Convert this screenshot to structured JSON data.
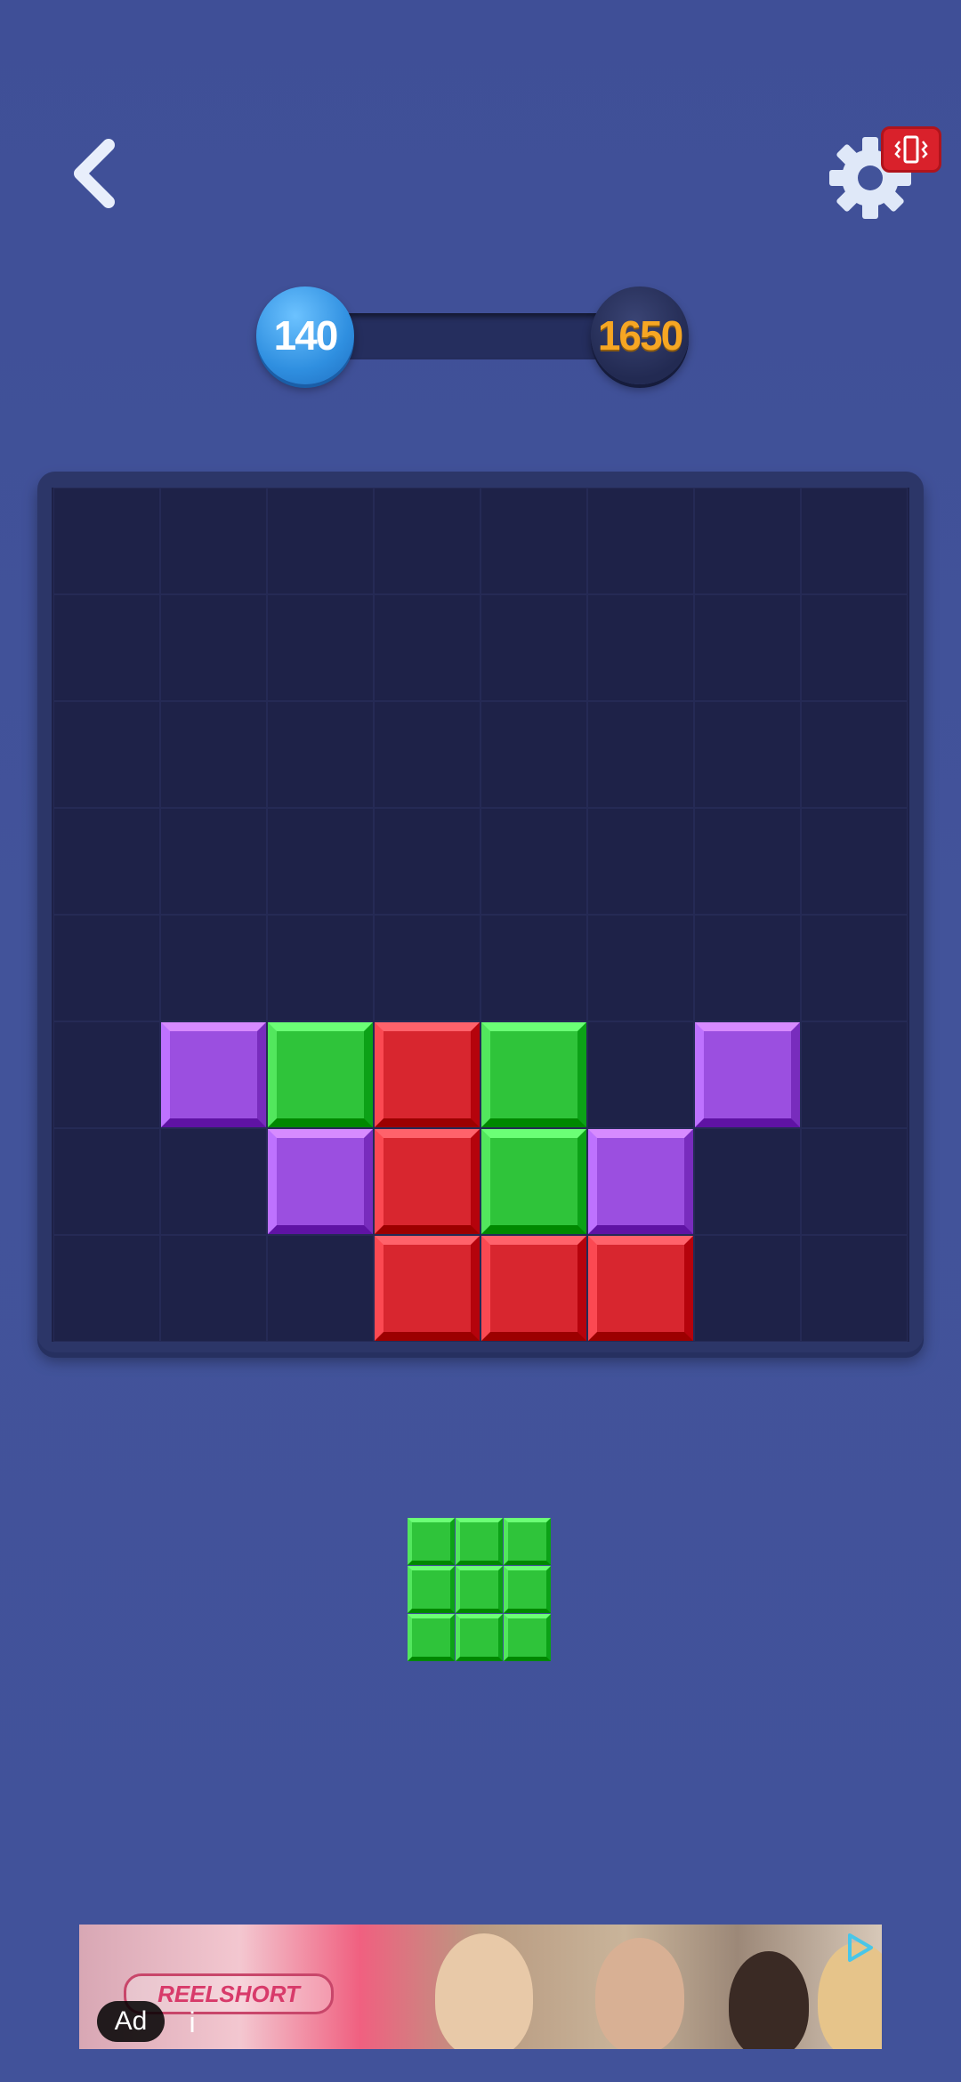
{
  "header": {
    "back_icon": "chevron-left-icon",
    "settings_icon": "gear-icon",
    "vibration_icon": "vibration-icon",
    "vibration_badge_color": "#d9212b"
  },
  "progress": {
    "current_score": "140",
    "target_score": "1650",
    "fraction": 0.085
  },
  "board": {
    "rows": 8,
    "cols": 8,
    "empty_cell_color": "#1e2248",
    "colors": {
      "P": "#9b4fe0",
      "G": "#2fc43a",
      "R": "#d8262f"
    },
    "grid": [
      "........",
      "........",
      "........",
      "........",
      "........",
      ".PGRG.P.",
      "..PRGP..",
      "...RRR.."
    ]
  },
  "next_piece": {
    "color": "#2fc43a",
    "shape": [
      "GGG",
      "GGG",
      "GGG"
    ]
  },
  "ad": {
    "badge": "Ad",
    "info": "i",
    "brand": "REELSHORT",
    "play_icon": "ad-choices-icon"
  }
}
